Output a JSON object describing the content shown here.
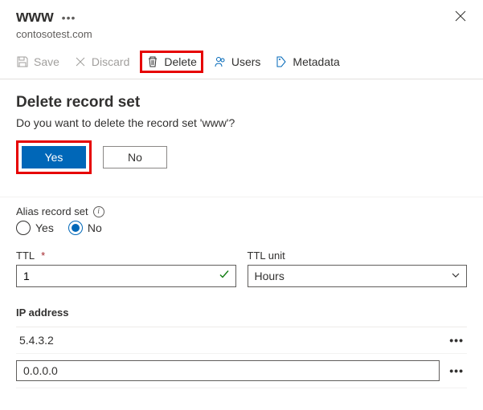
{
  "header": {
    "title": "www",
    "subtitle": "contosotest.com"
  },
  "toolbar": {
    "save": "Save",
    "discard": "Discard",
    "delete": "Delete",
    "users": "Users",
    "metadata": "Metadata"
  },
  "dialog": {
    "title": "Delete record set",
    "prompt": "Do you want to delete the record set 'www'?",
    "yes": "Yes",
    "no": "No"
  },
  "alias": {
    "label": "Alias record set",
    "yes": "Yes",
    "no": "No",
    "selected": "No"
  },
  "ttl": {
    "label": "TTL",
    "value": "1",
    "unit_label": "TTL unit",
    "unit_value": "Hours"
  },
  "ip": {
    "header": "IP address",
    "rows": [
      "5.4.3.2"
    ],
    "new_value": "0.0.0.0"
  }
}
